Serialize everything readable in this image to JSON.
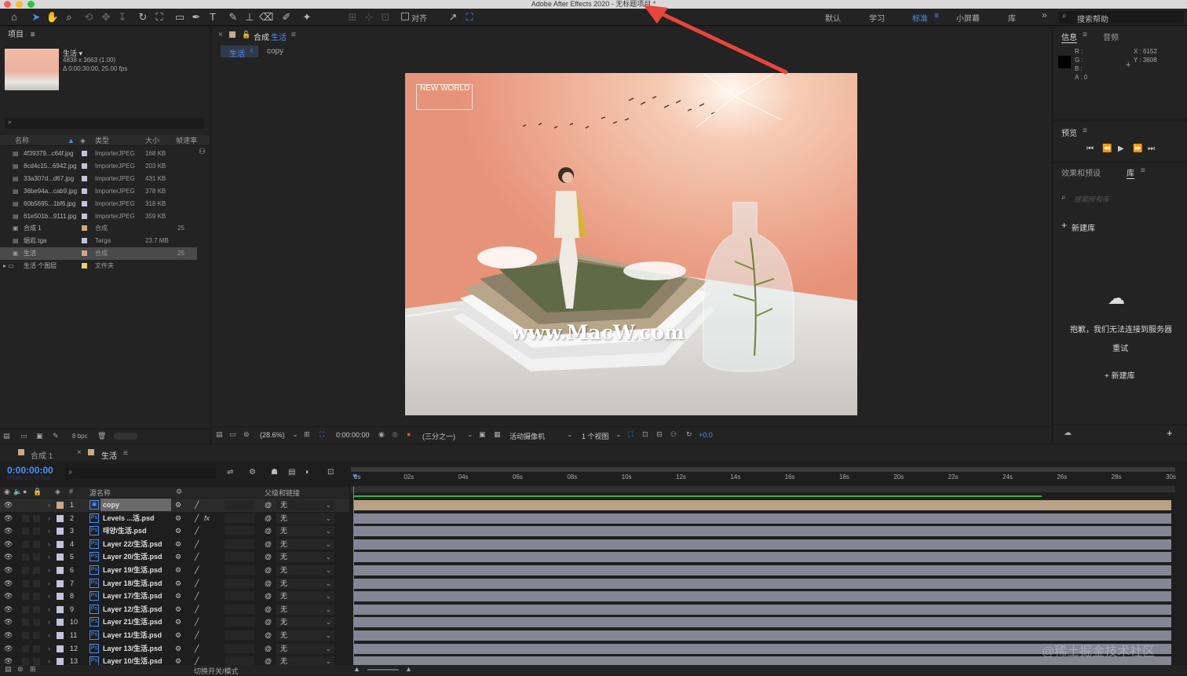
{
  "window": {
    "title": "Adobe After Effects 2020 - 无标题项目 *"
  },
  "toolbar": {
    "align_label": "对齐",
    "workspaces": [
      "默认",
      "学习",
      "标准",
      "小屏幕",
      "库"
    ],
    "more": "»",
    "help_placeholder": "搜索帮助"
  },
  "project": {
    "title": "项目",
    "menu": "≡",
    "comp_name": "生活 ▾",
    "comp_dims": "4838 x 3663 (1.00)",
    "comp_duration": "Δ 0:00:30:00, 25.00 fps",
    "columns": {
      "name": "名称",
      "type": "类型",
      "size": "大小",
      "fps": "帧速率"
    },
    "items": [
      {
        "name": "4f39379...c64f.jpg",
        "type": "ImporterJPEG",
        "size": "168 KB",
        "fps": "",
        "color": "#c3c3db"
      },
      {
        "name": "8cd4c15...6942.jpg",
        "type": "ImporterJPEG",
        "size": "203 KB",
        "fps": "",
        "color": "#c3c3db"
      },
      {
        "name": "33a307d...d67.jpg",
        "type": "ImporterJPEG",
        "size": "431 KB",
        "fps": "",
        "color": "#c3c3db"
      },
      {
        "name": "36be94a...cab9.jpg",
        "type": "ImporterJPEG",
        "size": "378 KB",
        "fps": "",
        "color": "#c3c3db"
      },
      {
        "name": "60b5695...1bf6.jpg",
        "type": "ImporterJPEG",
        "size": "318 KB",
        "fps": "",
        "color": "#c3c3db"
      },
      {
        "name": "61e501b...9111.jpg",
        "type": "ImporterJPEG",
        "size": "359 KB",
        "fps": "",
        "color": "#c3c3db"
      },
      {
        "name": "合成 1",
        "type": "合成",
        "size": "",
        "fps": "25",
        "color": "#c9a98a"
      },
      {
        "name": "烟岩.tga",
        "type": "Targa",
        "size": "23.7 MB",
        "fps": "",
        "color": "#c3c3db"
      },
      {
        "name": "生活",
        "type": "合成",
        "size": "",
        "fps": "25",
        "color": "#c9a98a"
      },
      {
        "name": "生活 个图层",
        "type": "文件夹",
        "size": "",
        "fps": "",
        "color": "#e6d46a"
      }
    ],
    "bpc": "8 bpc"
  },
  "composition": {
    "panel_label": "合成",
    "panel_name": "生活",
    "crumb_active": "生活",
    "crumb_child": "copy",
    "canvas_title": "NEW WORLD",
    "watermark": "www.MacW.com",
    "zoom": "(28.6%)",
    "timecode": "0:00:00:00",
    "resolution": "(三分之一)",
    "camera": "活动摄像机",
    "views": "1 个视图",
    "exposure": "+0.0"
  },
  "info": {
    "tab1": "信息",
    "tab2": "音频",
    "r": "R :",
    "g": "G :",
    "b": "B :",
    "a": "A : 0",
    "x": "X : 6152",
    "y": "Y : 3608"
  },
  "preview": {
    "title": "预览"
  },
  "library": {
    "tab1": "效果和预设",
    "tab2": "库",
    "search_placeholder": "搜索所有库",
    "new_lib": "新建库",
    "error": "抱歉，我们无法连接到服务器",
    "retry": "重试",
    "new_lib2": "+ 新建库"
  },
  "timeline": {
    "tab1": "合成 1",
    "tab2": "生活",
    "timecode": "0:00:00:00",
    "fps_info": "00000 (25.00 fps)",
    "col_source": "源名称",
    "col_parent": "父级和链接",
    "col_num": "#",
    "ruler": [
      "0s",
      "02s",
      "04s",
      "06s",
      "08s",
      "10s",
      "12s",
      "14s",
      "16s",
      "18s",
      "20s",
      "22s",
      "24s",
      "26s",
      "28s",
      "30s"
    ],
    "layers": [
      {
        "num": "1",
        "name": "copy",
        "parent": "无",
        "color": "#c9a98a"
      },
      {
        "num": "2",
        "name": "Levels ...活.psd",
        "parent": "无",
        "color": "#c3c3db"
      },
      {
        "num": "3",
        "name": "태양/生活.psd",
        "parent": "无",
        "color": "#c3c3db"
      },
      {
        "num": "4",
        "name": "Layer 22/生活.psd",
        "parent": "无",
        "color": "#c3c3db"
      },
      {
        "num": "5",
        "name": "Layer 20/生活.psd",
        "parent": "无",
        "color": "#c3c3db"
      },
      {
        "num": "6",
        "name": "Layer 19/生活.psd",
        "parent": "无",
        "color": "#c3c3db"
      },
      {
        "num": "7",
        "name": "Layer 18/生活.psd",
        "parent": "无",
        "color": "#c3c3db"
      },
      {
        "num": "8",
        "name": "Layer 17/生活.psd",
        "parent": "无",
        "color": "#c3c3db"
      },
      {
        "num": "9",
        "name": "Layer 12/生活.psd",
        "parent": "无",
        "color": "#c3c3db"
      },
      {
        "num": "10",
        "name": "Layer 21/生活.psd",
        "parent": "无",
        "color": "#c3c3db"
      },
      {
        "num": "11",
        "name": "Layer 11/生活.psd",
        "parent": "无",
        "color": "#c3c3db"
      },
      {
        "num": "12",
        "name": "Layer 13/生活.psd",
        "parent": "无",
        "color": "#c3c3db"
      },
      {
        "num": "13",
        "name": "Layer 10/生活.psd",
        "parent": "无",
        "color": "#c3c3db"
      }
    ],
    "toggle_label": "切换开关/模式"
  },
  "corner_watermark": "@稀土掘金技术社区"
}
